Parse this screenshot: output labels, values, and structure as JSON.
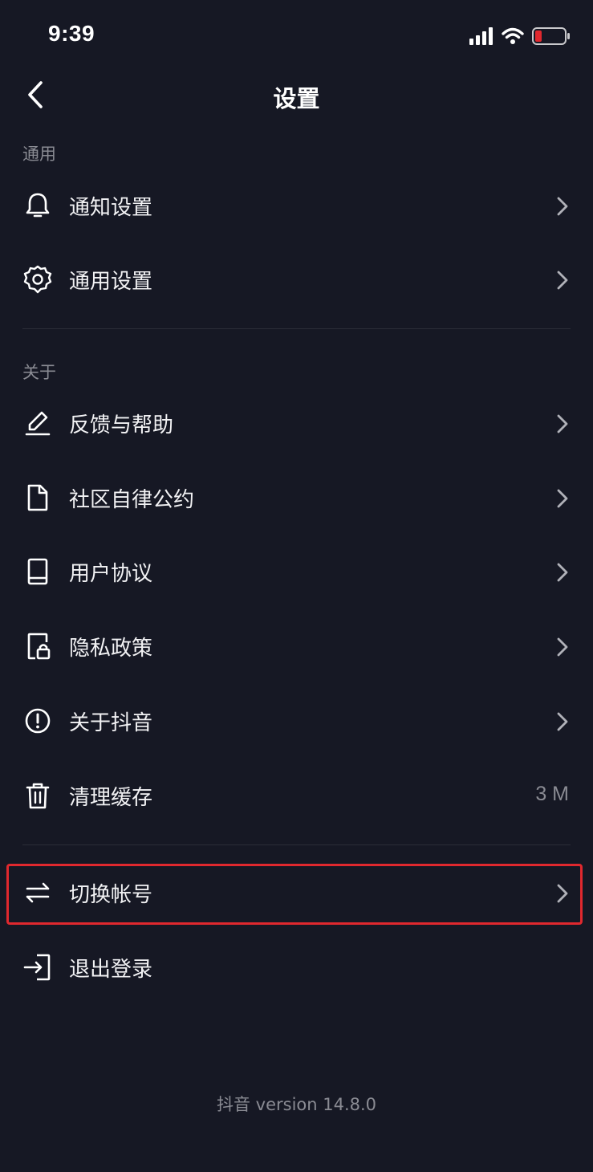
{
  "status_bar": {
    "time": "9:39",
    "battery_color": "#e0282e"
  },
  "nav": {
    "title": "设置",
    "back_icon": "chevron-left-icon"
  },
  "sections": [
    {
      "header": "通用",
      "items": [
        {
          "label": "通知设置",
          "icon": "bell-icon"
        },
        {
          "label": "通用设置",
          "icon": "gear-icon"
        }
      ]
    },
    {
      "header": "关于",
      "items": [
        {
          "label": "反馈与帮助",
          "icon": "pencil-icon"
        },
        {
          "label": "社区自律公约",
          "icon": "document-icon"
        },
        {
          "label": "用户协议",
          "icon": "book-icon"
        },
        {
          "label": "隐私政策",
          "icon": "lock-document-icon"
        },
        {
          "label": "关于抖音",
          "icon": "info-circle-icon"
        },
        {
          "label": "清理缓存",
          "icon": "trash-icon",
          "value": "3 M"
        }
      ]
    }
  ],
  "account": [
    {
      "label": "切换帐号",
      "icon": "swap-arrows-icon",
      "highlighted": true
    },
    {
      "label": "退出登录",
      "icon": "logout-icon"
    }
  ],
  "version_text": "抖音 version 14.8.0",
  "highlight_color": "#e0282e"
}
